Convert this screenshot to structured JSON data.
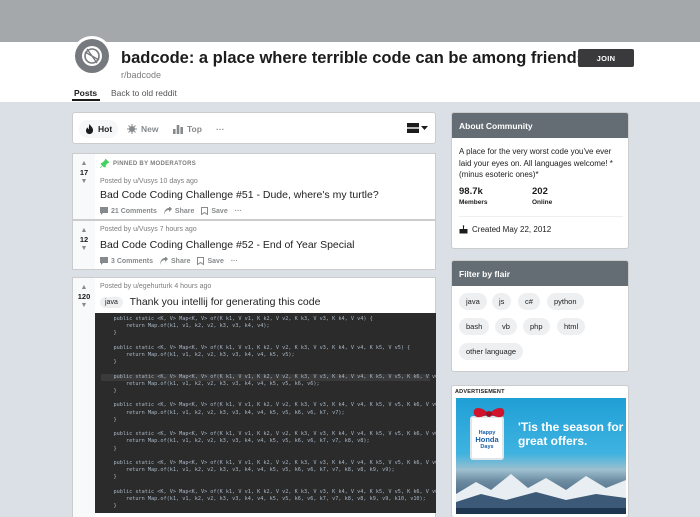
{
  "subreddit": {
    "title": "badcode: a place where terrible code can be among friends",
    "name": "r/badcode",
    "join_label": "JOIN"
  },
  "nav": {
    "tabs": [
      {
        "label": "Posts"
      },
      {
        "label": "Back to old reddit"
      }
    ]
  },
  "sort": {
    "hot": "Hot",
    "new": "New",
    "top": "Top",
    "more": "···"
  },
  "posts": [
    {
      "pinned_label": "PINNED BY MODERATORS",
      "votes": "17",
      "meta": "Posted by u/Vusys 10 days ago",
      "title": "Bad Code Coding Challenge #51 - Dude, where's my turtle?",
      "comments": "21 Comments",
      "share": "Share",
      "save": "Save",
      "more": "···"
    },
    {
      "votes": "12",
      "meta": "Posted by u/Vusys 7 hours ago",
      "title": "Bad Code Coding Challenge #52 - End of Year Special",
      "comments": "3 Comments",
      "share": "Share",
      "save": "Save",
      "more": "···"
    },
    {
      "votes": "120",
      "meta": "Posted by u/egehurturk 4 hours ago",
      "flair": "java",
      "title": "Thank you intellij for generating this code"
    }
  ],
  "code_lines": [
    "    public static <K, V> Map<K, V> of(K k1, V v1, K k2, V v2, K k3, V v3, K k4, V v4) {",
    "        return Map.of(k1, v1, k2, v2, k3, v3, k4, v4);",
    "    }",
    "",
    "    public static <K, V> Map<K, V> of(K k1, V v1, K k2, V v2, K k3, V v3, K k4, V v4, K k5, V v5) {",
    "        return Map.of(k1, v1, k2, v2, k3, v3, k4, v4, k5, v5);",
    "    }",
    "",
    "    public static <K, V> Map<K, V> of(K k1, V v1, K k2, V v2, K k3, V v3, K k4, V v4, K k5, V v5, K k6, V v6) {",
    "        return Map.of(k1, v1, k2, v2, k3, v3, k4, v4, k5, v5, k6, v6);",
    "    }",
    "",
    "    public static <K, V> Map<K, V> of(K k1, V v1, K k2, V v2, K k3, V v3, K k4, V v4, K k5, V v5, K k6, V v6, K k7, V v7) {",
    "        return Map.of(k1, v1, k2, v2, k3, v3, k4, v4, k5, v5, k6, v6, k7, v7);",
    "    }",
    "",
    "    public static <K, V> Map<K, V> of(K k1, V v1, K k2, V v2, K k3, V v3, K k4, V v4, K k5, V v5, K k6, V v6, K k7, V v7, K k8, V v8) {",
    "        return Map.of(k1, v1, k2, v2, k3, v3, k4, v4, k5, v5, k6, v6, k7, v7, k8, v8);",
    "    }",
    "",
    "    public static <K, V> Map<K, V> of(K k1, V v1, K k2, V v2, K k3, V v3, K k4, V v4, K k5, V v5, K k6, V v6, K k7, V v7, K k8, V v8, K k9, V v9) {",
    "        return Map.of(k1, v1, k2, v2, k3, v3, k4, v4, k5, v5, k6, v6, k7, v7, k8, v8, k9, v9);",
    "    }",
    "",
    "    public static <K, V> Map<K, V> of(K k1, V v1, K k2, V v2, K k3, V v3, K k4, V v4, K k5, V v5, K k6, V v6, K k7, V v7, K k8, V v8, K k9, V v9, K k10, V v10) {",
    "        return Map.of(k1, v1, k2, v2, k3, v3, k4, v4, k5, v5, k6, v6, k7, v7, k8, v8, k9, v9, k10, v10);",
    "    }"
  ],
  "about": {
    "heading": "About Community",
    "description": "A place for the very worst code you've ever laid your eyes on. All languages welcome! *(minus esoteric ones)*",
    "members_count": "98.7k",
    "members_label": "Members",
    "online_count": "202",
    "online_label": "Online",
    "created": "Created May 22, 2012"
  },
  "flair_filter": {
    "heading": "Filter by flair",
    "flairs": [
      "java",
      "js",
      "c#",
      "python",
      "bash",
      "vb",
      "php",
      "html",
      "other language"
    ]
  },
  "ad": {
    "label": "ADVERTISEMENT",
    "brand_line1": "Happy",
    "brand_line2": "Honda",
    "brand_line3": "Days",
    "tagline": "'Tis the season for great offers."
  },
  "colors": {
    "banner": "#a5a8ab",
    "card_header": "#646d73",
    "join_button": "#3a3a3c",
    "pin": "#46d160",
    "code_bg": "#2b2b2b"
  }
}
